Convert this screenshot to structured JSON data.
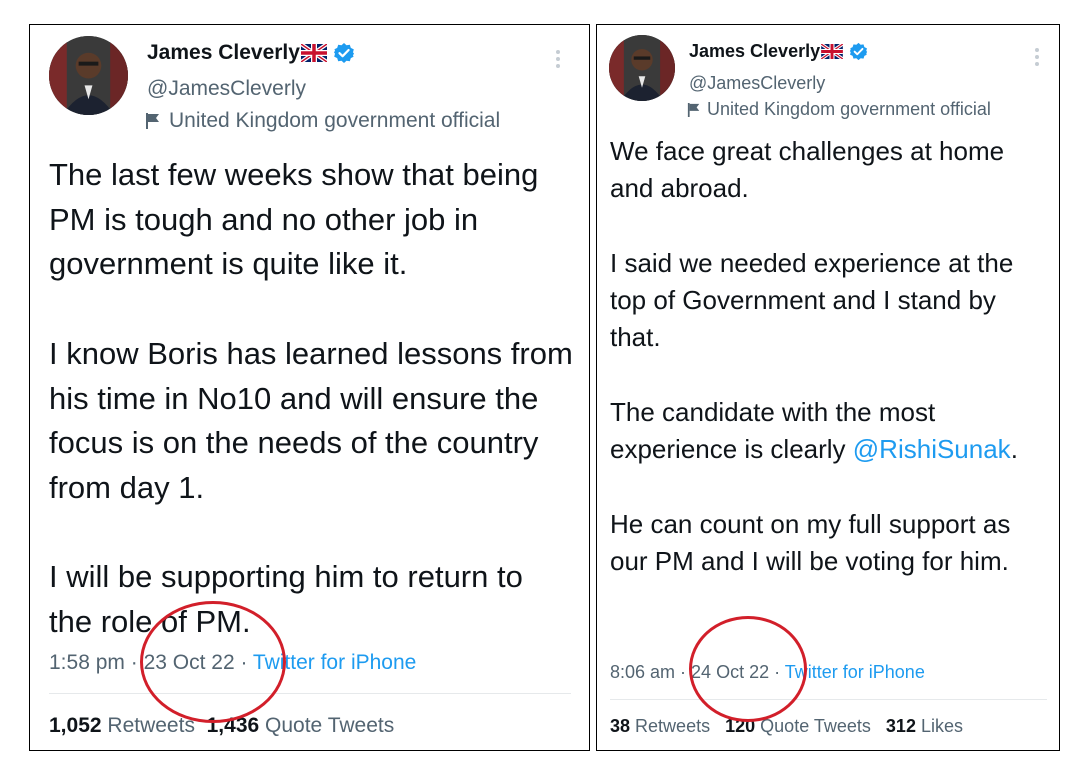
{
  "colors": {
    "link": "#1d9bf0",
    "muted": "#536471",
    "text": "#0f1419",
    "verified": "#1d9bf0",
    "annotation_circle": "#d21f2a"
  },
  "icons": {
    "verified": "verified-badge-icon",
    "country_flag": "uk-flag-icon",
    "gov_label": "government-flag-icon",
    "more": "more-options-icon"
  },
  "left_tweet": {
    "author": {
      "name": "James Cleverly",
      "handle": "@JamesCleverly",
      "label": "United Kingdom government official"
    },
    "paragraphs": [
      "The last few weeks show that being PM is tough and no other job in government is quite like it.",
      "I know Boris has learned lessons from his time in No10 and will ensure the focus is on the needs of the country from day 1.",
      "I will be supporting him to return to the role of PM."
    ],
    "meta": {
      "time": "1:58 pm",
      "sep1": " · ",
      "date": "23 Oct 22",
      "sep2": " · ",
      "source": "Twitter for iPhone"
    },
    "stats": {
      "retweets_count": "1,052",
      "retweets_label": "Retweets",
      "quotes_count": "1,436",
      "quotes_label": "Quote Tweets"
    }
  },
  "right_tweet": {
    "author": {
      "name": "James Cleverly",
      "handle": "@JamesCleverly",
      "label": "United Kingdom government official"
    },
    "paragraphs": [
      "We face great challenges at home and abroad.",
      "I said we needed experience at the top of Government and I stand by that."
    ],
    "p3_text": "The candidate with the most experience is clearly ",
    "p3_mention": "@RishiSunak",
    "p3_end": ".",
    "p4_text": "He can count on my full support as our PM and I will be voting for him.",
    "meta": {
      "time": "8:06 am",
      "sep1": " · ",
      "date": "24 Oct 22",
      "sep2": " · ",
      "source": "Twitter for iPhone"
    },
    "stats": {
      "retweets_count": "38",
      "retweets_label": "Retweets",
      "quotes_count": "120",
      "quotes_label": "Quote Tweets",
      "likes_count": "312",
      "likes_label": "Likes"
    }
  }
}
